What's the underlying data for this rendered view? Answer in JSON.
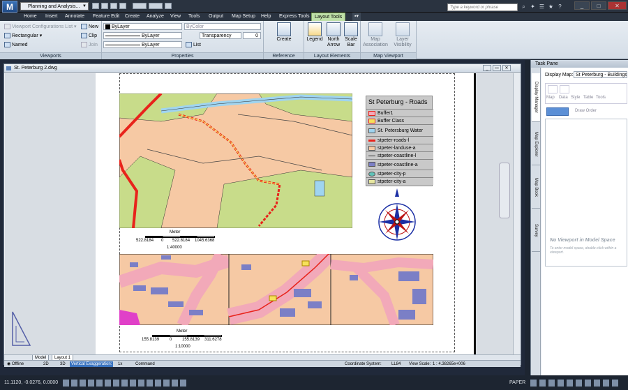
{
  "app": {
    "title": "Planning and Analysis...",
    "search_placeholder": "Type a keyword or phrase",
    "logo_letter": "M"
  },
  "tabs": [
    "Home",
    "Insert",
    "Annotate",
    "Feature Edit",
    "Create",
    "Analyze",
    "View",
    "Tools",
    "Output",
    "Map Setup",
    "Help",
    "Express Tools",
    "Layout Tools"
  ],
  "active_tab": "Layout Tools",
  "ribbon": {
    "viewports": {
      "label": "Viewports",
      "items": [
        "Viewport Configurations List",
        "Rectangular",
        "Named",
        "New",
        "Clip",
        "Join"
      ]
    },
    "properties": {
      "label": "Properties",
      "bylayer1": "ByLayer",
      "bylayer2": "ByLayer",
      "bylayer3": "ByLayer",
      "bycolor": "ByColor",
      "transparency": "Transparency",
      "transparency_value": "0",
      "list": "List"
    },
    "reference": {
      "label": "Reference System",
      "create": "Create"
    },
    "layout": {
      "label": "Layout Elements",
      "legend": "Legend",
      "north": "North Arrow",
      "scale": "Scale Bar"
    },
    "mapvp": {
      "label": "Map Viewport",
      "assoc": "Map Association",
      "vis": "Layer Visibility"
    }
  },
  "drawing": {
    "title": "St. Peterburg 2.dwg",
    "legend": {
      "title": "St Peterburg - Roads",
      "items": [
        "Buffer1",
        "Buffer Class",
        "St. Petersburg Water",
        "stpeter-roads-l",
        "stpeter-landuse-a",
        "stpeter-coastline-l",
        "stpeter-coastline-a",
        "stpeter-city-p",
        "stpeter-city-a"
      ]
    },
    "scalebar1": {
      "unit": "Meter",
      "ticks": [
        "522.8184",
        "0",
        "522.8184",
        "1045.6368"
      ],
      "ratio": "1:40000"
    },
    "scalebar2": {
      "unit": "Meter",
      "ticks": [
        "155.8139",
        "0",
        "155.8139",
        "311.6278"
      ],
      "ratio": "1:10000"
    }
  },
  "layout_tabs": [
    "Model",
    "Layout 1"
  ],
  "lower": {
    "offline": "Offline",
    "d2": "2D",
    "d3": "3D",
    "vexag": "Vertical Exaggeration:",
    "vexag_val": "1x",
    "command": "Command",
    "coord_label": "Coordinate System:",
    "coord_val": "LL84",
    "scale_label": "View Scale:",
    "scale_val": "1 : 4.38265e+006"
  },
  "taskpane": {
    "title": "Task Pane",
    "display_map_label": "Display Map:",
    "display_map_value": "St Peterburg - Buildings",
    "tools": [
      "Map",
      "Data",
      "Style",
      "Table",
      "Tools"
    ],
    "draw_order": "Draw Order",
    "no_viewport": "No Viewport in Model Space",
    "hint": "To enter model space, double-click within a viewport.",
    "side_tabs": [
      "Display Manager",
      "Map Explorer",
      "Map Book",
      "Survey"
    ]
  },
  "status": {
    "coords": "11.1120, -0.0276, 0.0000",
    "paper": "PAPER"
  },
  "colors": {
    "land": "#f6c9a4",
    "green": "#c8dc8a",
    "road": "#e8231b",
    "water": "#9fd4f0",
    "building": "#7b7fc6",
    "roadpink": "#f2a9b9",
    "tab_active": "#bfe0a8"
  }
}
